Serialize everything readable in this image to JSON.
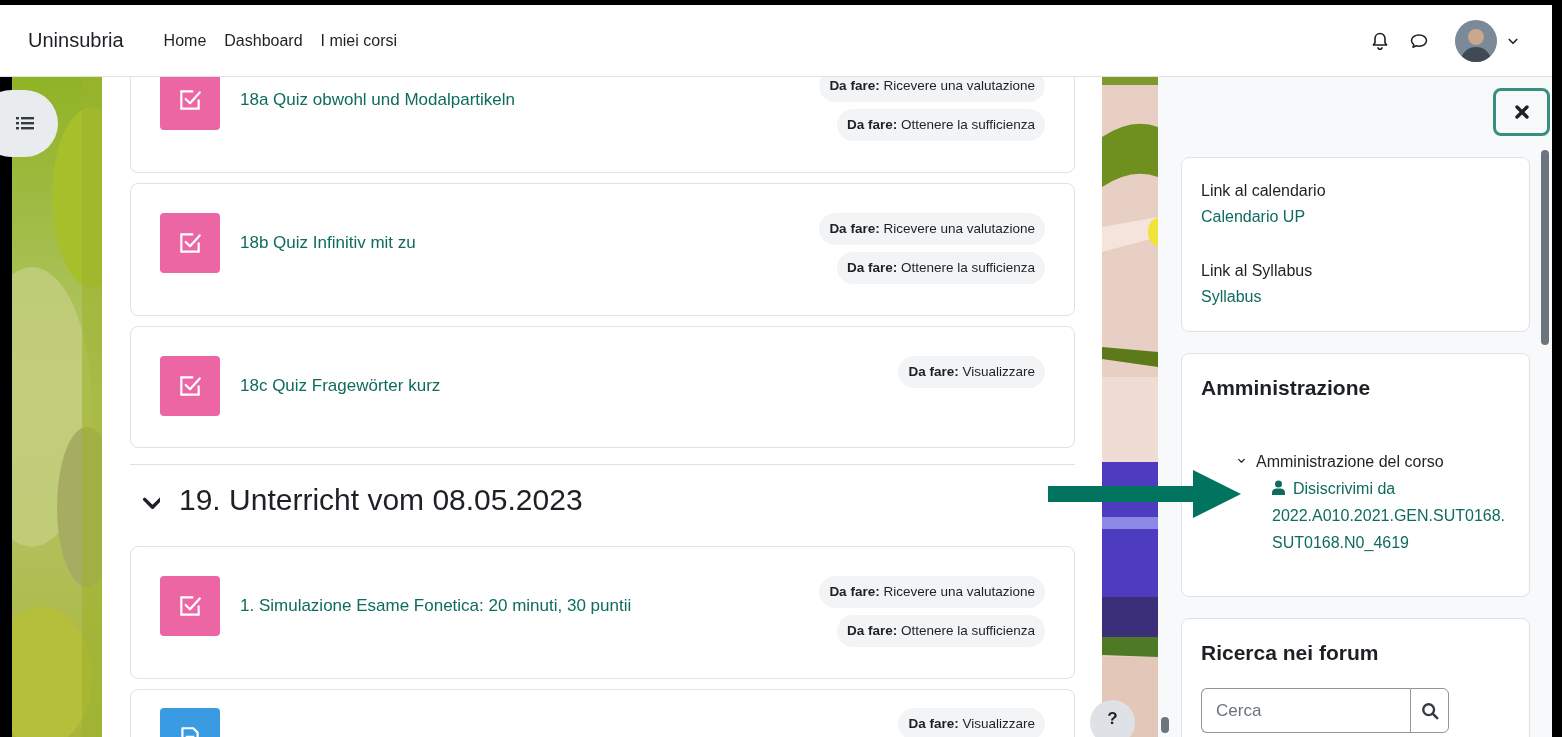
{
  "navbar": {
    "brand": "Uninsubria",
    "links": [
      {
        "label": "Home"
      },
      {
        "label": "Dashboard"
      },
      {
        "label": "I miei corsi"
      }
    ]
  },
  "activities": [
    {
      "kind": "quiz",
      "title": "18a Quiz obwohl und Modalpartikeln",
      "completion": [
        "**Da fare:** Ricevere una valutazione",
        "**Da fare:** Ottenere la sufficienza"
      ]
    },
    {
      "kind": "quiz",
      "title": "18b Quiz Infinitiv mit zu",
      "completion": [
        "**Da fare:** Ricevere una valutazione",
        "**Da fare:** Ottenere la sufficienza"
      ]
    },
    {
      "kind": "quiz",
      "title": "18c Quiz Fragewörter kurz",
      "completion": [
        "**Da fare:** Visualizzare"
      ]
    }
  ],
  "section": {
    "title": "19. Unterricht vom 08.05.2023",
    "expanded": true,
    "activities": [
      {
        "kind": "quiz",
        "title": "1. Simulazione Esame Fonetica: 20 minuti, 30 puntii",
        "completion": [
          "**Da fare:** Ricevere una valutazione",
          "**Da fare:** Ottenere la sufficienza"
        ]
      },
      {
        "kind": "page",
        "completion": [
          "**Da fare:** Visualizzare"
        ]
      }
    ]
  },
  "help_button": "?",
  "drawer": {
    "blocks": [
      {
        "kind": "links",
        "items": [
          {
            "label": "Link al calendario",
            "link": "Calendario UP"
          },
          {
            "label": "Link al Syllabus",
            "link": "Syllabus"
          }
        ]
      },
      {
        "kind": "tree",
        "title": "Amministrazione",
        "nodes": [
          {
            "label": "Amministrazione del corso",
            "expanded": true,
            "children": [
              {
                "label": "Disiscrivimi da 2022.A010.2021.GEN.SUT0168.SUT0168.N0_4619"
              }
            ]
          }
        ]
      },
      {
        "kind": "search",
        "title": "Ricerca nei forum",
        "placeholder": "Cerca"
      }
    ]
  }
}
